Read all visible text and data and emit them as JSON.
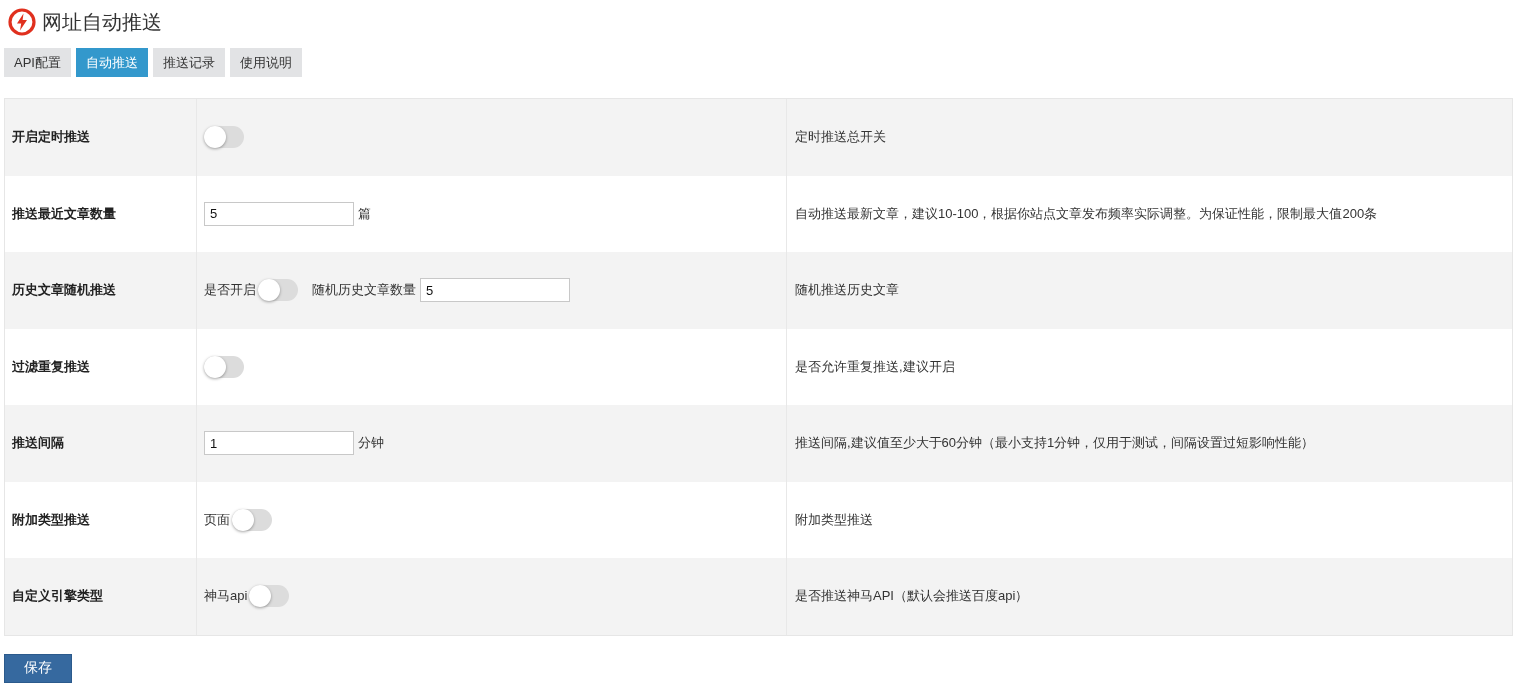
{
  "header": {
    "title": "网址自动推送"
  },
  "tabs": [
    {
      "label": "API配置",
      "selected": false
    },
    {
      "label": "自动推送",
      "selected": true
    },
    {
      "label": "推送记录",
      "selected": false
    },
    {
      "label": "使用说明",
      "selected": false
    }
  ],
  "settings": [
    {
      "label": "开启定时推送",
      "controls": [
        {
          "kind": "toggle",
          "on": false
        }
      ],
      "description": "定时推送总开关"
    },
    {
      "label": "推送最近文章数量",
      "controls": [
        {
          "kind": "input",
          "value": "5"
        },
        {
          "kind": "text",
          "text": "篇"
        }
      ],
      "description": "自动推送最新文章，建议10-100，根据你站点文章发布频率实际调整。为保证性能，限制最大值200条"
    },
    {
      "label": "历史文章随机推送",
      "controls": [
        {
          "kind": "text",
          "text": "是否开启"
        },
        {
          "kind": "toggle",
          "on": false
        },
        {
          "kind": "text",
          "text": "随机历史文章数量"
        },
        {
          "kind": "input",
          "value": "5"
        }
      ],
      "description": "随机推送历史文章"
    },
    {
      "label": "过滤重复推送",
      "controls": [
        {
          "kind": "toggle",
          "on": false
        }
      ],
      "description": "是否允许重复推送,建议开启"
    },
    {
      "label": "推送间隔",
      "controls": [
        {
          "kind": "input",
          "value": "1"
        },
        {
          "kind": "text",
          "text": "分钟"
        }
      ],
      "description": "推送间隔,建议值至少大于60分钟（最小支持1分钟，仅用于测试，间隔设置过短影响性能）"
    },
    {
      "label": "附加类型推送",
      "controls": [
        {
          "kind": "text",
          "text": "页面"
        },
        {
          "kind": "toggle",
          "on": false
        }
      ],
      "description": "附加类型推送"
    },
    {
      "label": "自定义引擎类型",
      "controls": [
        {
          "kind": "text",
          "text": "神马api"
        },
        {
          "kind": "toggle",
          "on": false
        }
      ],
      "description": "是否推送神马API（默认会推送百度api）"
    }
  ],
  "save_button": "保存"
}
